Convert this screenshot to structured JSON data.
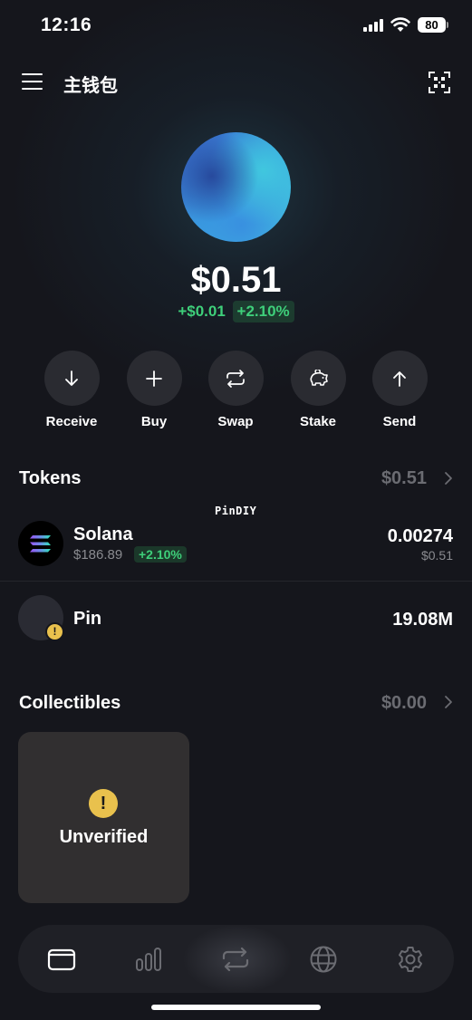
{
  "status_bar": {
    "time": "12:16",
    "battery": "80"
  },
  "header": {
    "title": "主钱包",
    "menu_icon": "hamburger-menu-icon",
    "scan_icon": "qr-scan-icon"
  },
  "account": {
    "balance": "$0.51",
    "change_amount": "+$0.01",
    "change_percent": "+2.10%"
  },
  "actions": [
    {
      "label": "Receive",
      "icon": "arrow-down-icon"
    },
    {
      "label": "Buy",
      "icon": "plus-icon"
    },
    {
      "label": "Swap",
      "icon": "swap-icon"
    },
    {
      "label": "Stake",
      "icon": "piggy-bank-icon"
    },
    {
      "label": "Send",
      "icon": "arrow-up-icon"
    }
  ],
  "tokens": {
    "title": "Tokens",
    "total": "$0.51",
    "items": [
      {
        "name": "Solana",
        "price": "$186.89",
        "change": "+2.10%",
        "amount": "0.00274",
        "value": "$0.51"
      },
      {
        "name": "Pin",
        "amount": "19.08M"
      }
    ]
  },
  "watermark": "PinDIY",
  "collectibles": {
    "title": "Collectibles",
    "total": "$0.00",
    "items": [
      {
        "label": "Unverified"
      }
    ]
  },
  "bottom_nav": [
    {
      "icon": "wallet-icon",
      "active": true
    },
    {
      "icon": "bar-chart-icon",
      "active": false
    },
    {
      "icon": "swap-icon",
      "active": false
    },
    {
      "icon": "globe-icon",
      "active": false
    },
    {
      "icon": "settings-gear-icon",
      "active": false
    }
  ],
  "colors": {
    "background": "#15161c",
    "positive": "#3ecf7a",
    "warning": "#e9c14d",
    "muted": "#6b6c72"
  }
}
